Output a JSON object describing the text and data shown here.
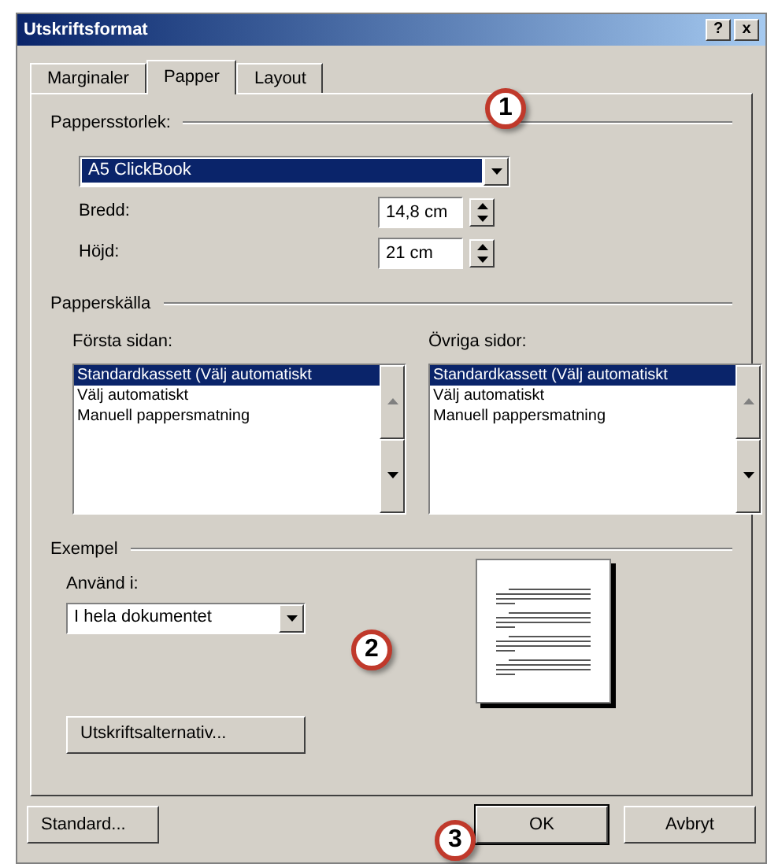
{
  "window": {
    "title": "Utskriftsformat",
    "help_button": "?",
    "close_button": "x"
  },
  "tabs": [
    {
      "label": "Marginaler",
      "selected": false
    },
    {
      "label": "Papper",
      "selected": true
    },
    {
      "label": "Layout",
      "selected": false
    }
  ],
  "paper_size": {
    "heading": "Pappersstorlek:",
    "value": "A5 ClickBook",
    "width_label": "Bredd:",
    "width_value": "14,8 cm",
    "height_label": "Höjd:",
    "height_value": "21 cm"
  },
  "paper_source": {
    "heading": "Papperskälla",
    "lists": [
      {
        "label": "Första sidan:",
        "items": [
          {
            "text": "Standardkassett (Välj automatiskt",
            "selected": true
          },
          {
            "text": "Välj automatiskt",
            "selected": false
          },
          {
            "text": "Manuell pappersmatning",
            "selected": false
          }
        ]
      },
      {
        "label": "Övriga sidor:",
        "items": [
          {
            "text": "Standardkassett (Välj automatiskt",
            "selected": true
          },
          {
            "text": "Välj automatiskt",
            "selected": false
          },
          {
            "text": "Manuell pappersmatning",
            "selected": false
          }
        ]
      }
    ]
  },
  "preview": {
    "heading": "Exempel",
    "apply_label": "Använd i:",
    "apply_value": "I hela dokumentet",
    "options_button": "Utskriftsalternativ..."
  },
  "buttons": [
    {
      "label": "Standard...",
      "default": false
    },
    {
      "label": "OK",
      "default": true
    },
    {
      "label": "Avbryt",
      "default": false
    }
  ],
  "callouts": [
    "1",
    "2",
    "3"
  ]
}
